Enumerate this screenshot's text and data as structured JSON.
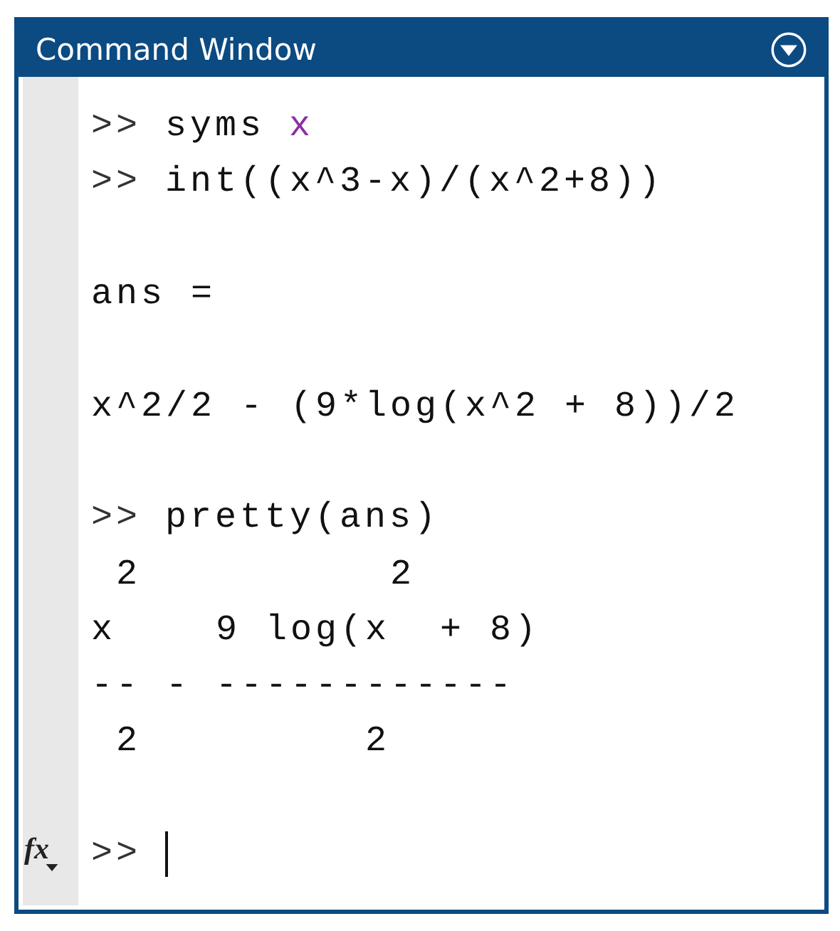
{
  "window": {
    "title": "Command Window"
  },
  "lines": [
    {
      "kind": "command",
      "prompt": ">>",
      "text": "syms",
      "argument": "x"
    },
    {
      "kind": "command",
      "prompt": ">>",
      "text": "int((x^3-x)/(x^2+8))"
    },
    {
      "kind": "blank"
    },
    {
      "kind": "output",
      "text": "ans ="
    },
    {
      "kind": "blank"
    },
    {
      "kind": "output",
      "text": "x^2/2 - (9*log(x^2 + 8))/2"
    },
    {
      "kind": "blank"
    },
    {
      "kind": "command",
      "prompt": ">>",
      "text": "pretty(ans)"
    },
    {
      "kind": "output",
      "text": " 2          2"
    },
    {
      "kind": "output",
      "text": "x    9 log(x  + 8)"
    },
    {
      "kind": "output",
      "text": "-- - ------------"
    },
    {
      "kind": "output",
      "text": " 2         2"
    },
    {
      "kind": "blank"
    }
  ],
  "input": {
    "button": "fx",
    "prompt": ">>"
  }
}
